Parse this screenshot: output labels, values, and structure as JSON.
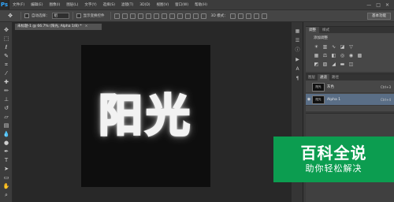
{
  "app": {
    "logo": "Ps"
  },
  "menu": [
    "文件(F)",
    "编辑(E)",
    "图像(I)",
    "图层(L)",
    "文字(Y)",
    "选择(S)",
    "滤镜(T)",
    "3D(D)",
    "视图(V)",
    "窗口(W)",
    "帮助(H)"
  ],
  "window_controls": [
    "—",
    "□",
    "✕"
  ],
  "options_bar": {
    "auto_select_label": "自动选择：",
    "auto_select_value": "组",
    "transform_controls_label": "显示变换控件",
    "mode_3d_label": "3D 模式：",
    "workspace_label": "基本功能"
  },
  "document": {
    "tab_title": "未标题-1 @ 66.7% (阳光, Alpha 1/8) *",
    "canvas_text": "阳光"
  },
  "adjustments_panel": {
    "tabs": [
      "调整",
      "样式"
    ],
    "title": "添加调整"
  },
  "layers_panel": {
    "tabs": [
      "图层",
      "通道",
      "路径"
    ],
    "rows": [
      {
        "thumb": "阳光",
        "name": "灰色",
        "shortcut": "Ctrl+3"
      },
      {
        "thumb": "阳光",
        "name": "Alpha 1",
        "shortcut": "Ctrl+4"
      }
    ]
  },
  "watermark": {
    "title": "百科全说",
    "subtitle": "助你轻松解决"
  }
}
